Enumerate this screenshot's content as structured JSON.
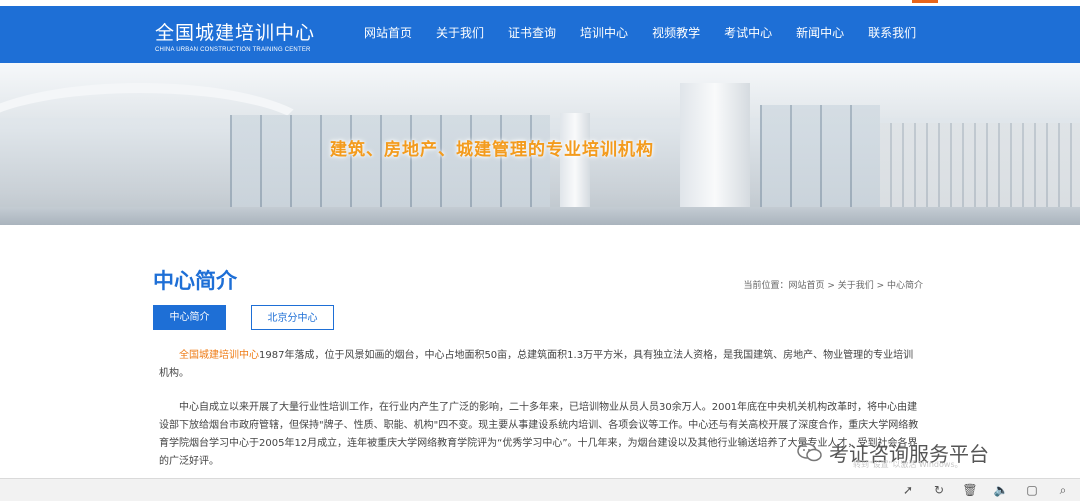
{
  "header": {
    "logo_cn": "全国城建培训中心",
    "logo_en": "CHINA URBAN CONSTRUCTION TRAINING CENTER",
    "nav": [
      "网站首页",
      "关于我们",
      "证书查询",
      "培训中心",
      "视频教学",
      "考试中心",
      "新闻中心",
      "联系我们"
    ]
  },
  "banner": {
    "slogan": "建筑、房地产、城建管理的专业培训机构"
  },
  "page": {
    "title": "中心简介",
    "breadcrumb": "当前位置：网站首页 > 关于我们 > 中心简介",
    "tabs": [
      "中心简介",
      "北京分中心"
    ],
    "p1_highlight": "全国城建培训中心",
    "p1_rest": "1987年落成，位于风景如画的烟台，中心占地面积50亩，总建筑面积1.3万平方米，具有独立法人资格，是我国建筑、房地产、物业管理的专业培训机构。",
    "p2": "中心自成立以来开展了大量行业性培训工作，在行业内产生了广泛的影响，二十多年来，已培训物业从员人员30余万人。2001年底在中央机关机构改革时，将中心由建设部下放给烟台市政府管辖，但保持\"牌子、性质、职能、机构\"四不变。现主要从事建设系统内培训、各项会议等工作。中心还与有关高校开展了深度合作，重庆大学网络教育学院烟台学习中心于2005年12月成立，连年被重庆大学网络教育学院评为“优秀学习中心”。十几年来，为烟台建设以及其他行业输送培养了大量专业人才，受到社会各界的广泛好评。"
  },
  "overlay": {
    "watermark": "考证咨询服务平台",
    "windows_hint": "转到\"设置\"以激活 Windows。"
  },
  "colors": {
    "brand_blue": "#1e6fd6",
    "orange": "#f39b1d"
  },
  "bottom_icons": [
    "rocket-icon",
    "refresh-icon",
    "trash-icon",
    "speaker-icon",
    "window-icon",
    "search-icon"
  ]
}
